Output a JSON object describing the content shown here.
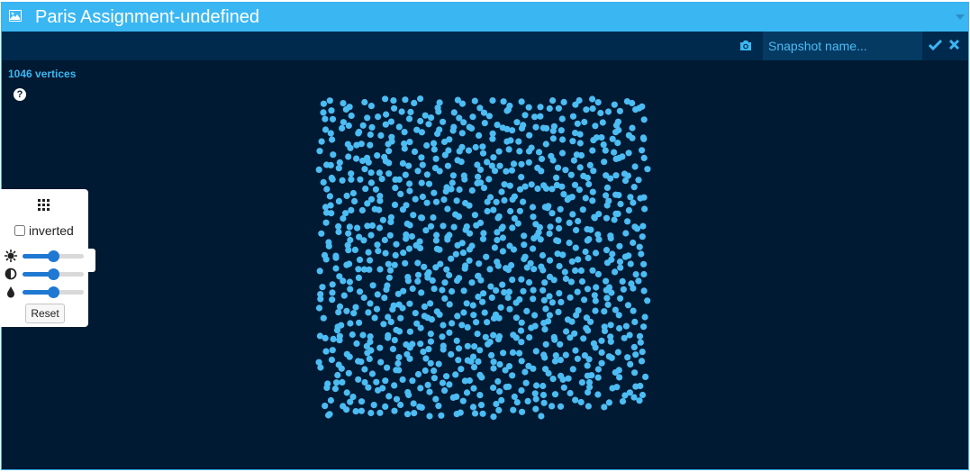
{
  "window": {
    "title": "Paris Assignment-undefined"
  },
  "snapshot": {
    "placeholder": "Snapshot name...",
    "value": ""
  },
  "graph": {
    "vertex_count_label": "1046 vertices",
    "help_glyph": "?",
    "vertex_color": "#4cbcf3",
    "vertex_count": 1046
  },
  "controls": {
    "inverted_label": "inverted",
    "inverted_checked": false,
    "brightness": 0.5,
    "contrast": 0.5,
    "saturation": 0.5,
    "reset_label": "Reset"
  },
  "icons": {
    "title_icon": "image-icon",
    "camera": "camera-icon",
    "confirm": "checkmark-icon",
    "cancel": "close-icon",
    "layout": "grid-icon",
    "brightness": "sun-icon",
    "contrast": "contrast-icon",
    "saturation": "drop-icon",
    "collapse": "caret-down-icon"
  },
  "colors": {
    "titlebar": "#3ab7f2",
    "background": "#001a33",
    "accent": "#4cbcf3",
    "slider": "#1f78d1"
  }
}
